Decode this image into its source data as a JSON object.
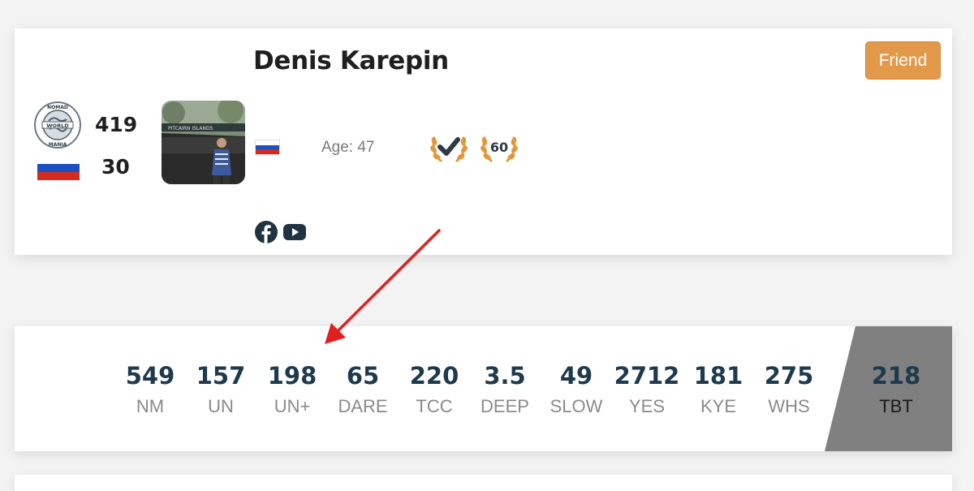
{
  "profile": {
    "name": "Denis Karepin",
    "friend_button": "Friend",
    "world_rank": "419",
    "country_rank": "30",
    "age_text": "Age: 47",
    "badges": [
      {
        "icon": "checkmark-laurel-icon"
      },
      {
        "icon": "laurel-60-icon",
        "text": "60"
      }
    ],
    "social": [
      "facebook-icon",
      "youtube-icon"
    ],
    "logo_text": {
      "top": "NOMAD",
      "mid": "WORLD",
      "bot": "MANIA"
    }
  },
  "stats": [
    {
      "value": "549",
      "label": "NM"
    },
    {
      "value": "157",
      "label": "UN"
    },
    {
      "value": "198",
      "label": "UN+"
    },
    {
      "value": "65",
      "label": "DARE"
    },
    {
      "value": "220",
      "label": "TCC"
    },
    {
      "value": "3.5",
      "label": "DEEP"
    },
    {
      "value": "49",
      "label": "SLOW"
    },
    {
      "value": "2712",
      "label": "YES"
    },
    {
      "value": "181",
      "label": "KYE"
    },
    {
      "value": "275",
      "label": "WHS"
    },
    {
      "value": "218",
      "label": "TBT"
    }
  ],
  "colors": {
    "accent": "#e29a4a",
    "stat_value": "#1f3a4d",
    "highlight_bg": "#808080",
    "arrow": "#e02020",
    "flag_white": "#ffffff",
    "flag_blue": "#1c4fc0",
    "flag_red": "#d52b1e"
  }
}
